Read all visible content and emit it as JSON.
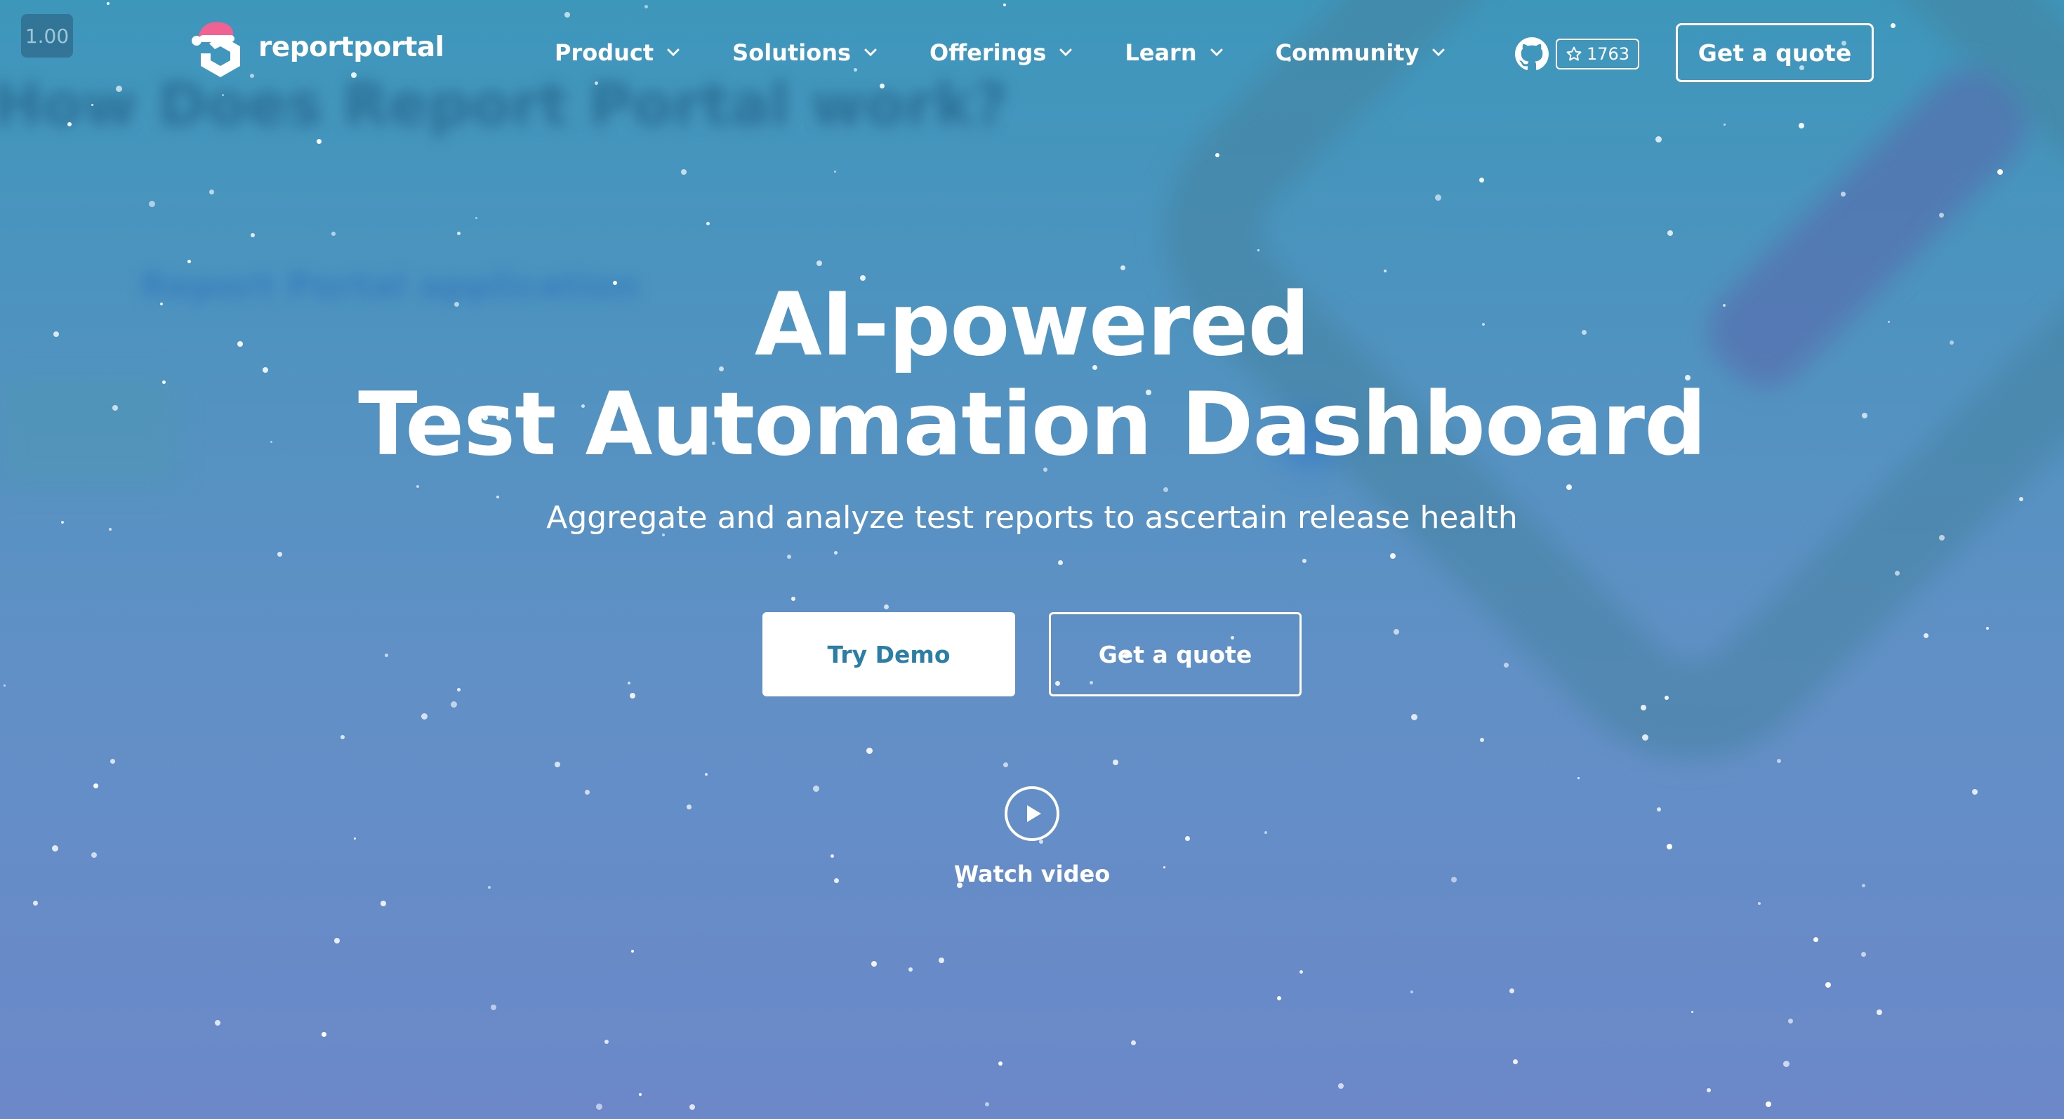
{
  "zoom_badge": "1.00",
  "logo": {
    "text": "reportportal",
    "icon": "reportportal-santa-hat-logo-icon"
  },
  "nav": {
    "items": [
      {
        "label": "Product",
        "icon": "chevron-down-icon"
      },
      {
        "label": "Solutions",
        "icon": "chevron-down-icon"
      },
      {
        "label": "Offerings",
        "icon": "chevron-down-icon"
      },
      {
        "label": "Learn",
        "icon": "chevron-down-icon"
      },
      {
        "label": "Community",
        "icon": "chevron-down-icon"
      }
    ]
  },
  "github": {
    "icon": "github-icon",
    "star_icon": "star-icon",
    "stars": "1763"
  },
  "header_cta": {
    "label": "Get a quote"
  },
  "background": {
    "blurred_heading": "How Does Report Portal work?",
    "blurred_subheading": "Report Portal application"
  },
  "hero": {
    "title_line1": "AI-powered",
    "title_line2": "Test Automation Dashboard",
    "subtitle": "Aggregate and analyze test reports to ascertain release health",
    "primary_button": "Try Demo",
    "secondary_button": "Get a quote",
    "video_icon": "play-circle-icon",
    "video_label": "Watch video"
  },
  "colors": {
    "primary": "#2b7fa6",
    "accent_hat": "#f06292",
    "bg_top": "#3d97bb",
    "bg_bottom": "#6c88c9"
  }
}
